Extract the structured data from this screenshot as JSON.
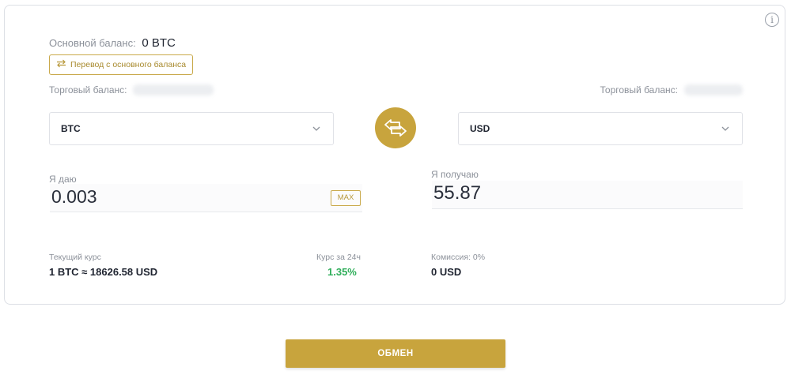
{
  "balances": {
    "main_label": "Основной баланс:",
    "main_value": "0 BTC",
    "transfer_label": "Перевод с основного баланса",
    "trade_label_left": "Торговый баланс:",
    "trade_label_right": "Торговый баланс:"
  },
  "from": {
    "currency": "BTC",
    "amount_label": "Я даю",
    "amount": "0.003",
    "max_label": "MAX"
  },
  "to": {
    "currency": "USD",
    "amount_label": "Я получаю",
    "amount": "55.87"
  },
  "stats": {
    "rate_label": "Текущий курс",
    "rate_value": "1 BTC ≈ 18626.58 USD",
    "change_label": "Курс за 24ч",
    "change_value": "1.35%",
    "fee_label": "Комиссия: 0%",
    "fee_value": "0 USD"
  },
  "action": {
    "exchange_label": "ОБМЕН"
  },
  "colors": {
    "accent": "#c8a43d",
    "positive": "#2fae5a",
    "border": "#dcdfe5",
    "muted": "#8c919a"
  },
  "icons": {
    "info": "info-circle-icon",
    "transfer": "transfer-arrows-icon",
    "swap": "swap-arrows-icon",
    "dropdown": "chevron-down-icon"
  }
}
